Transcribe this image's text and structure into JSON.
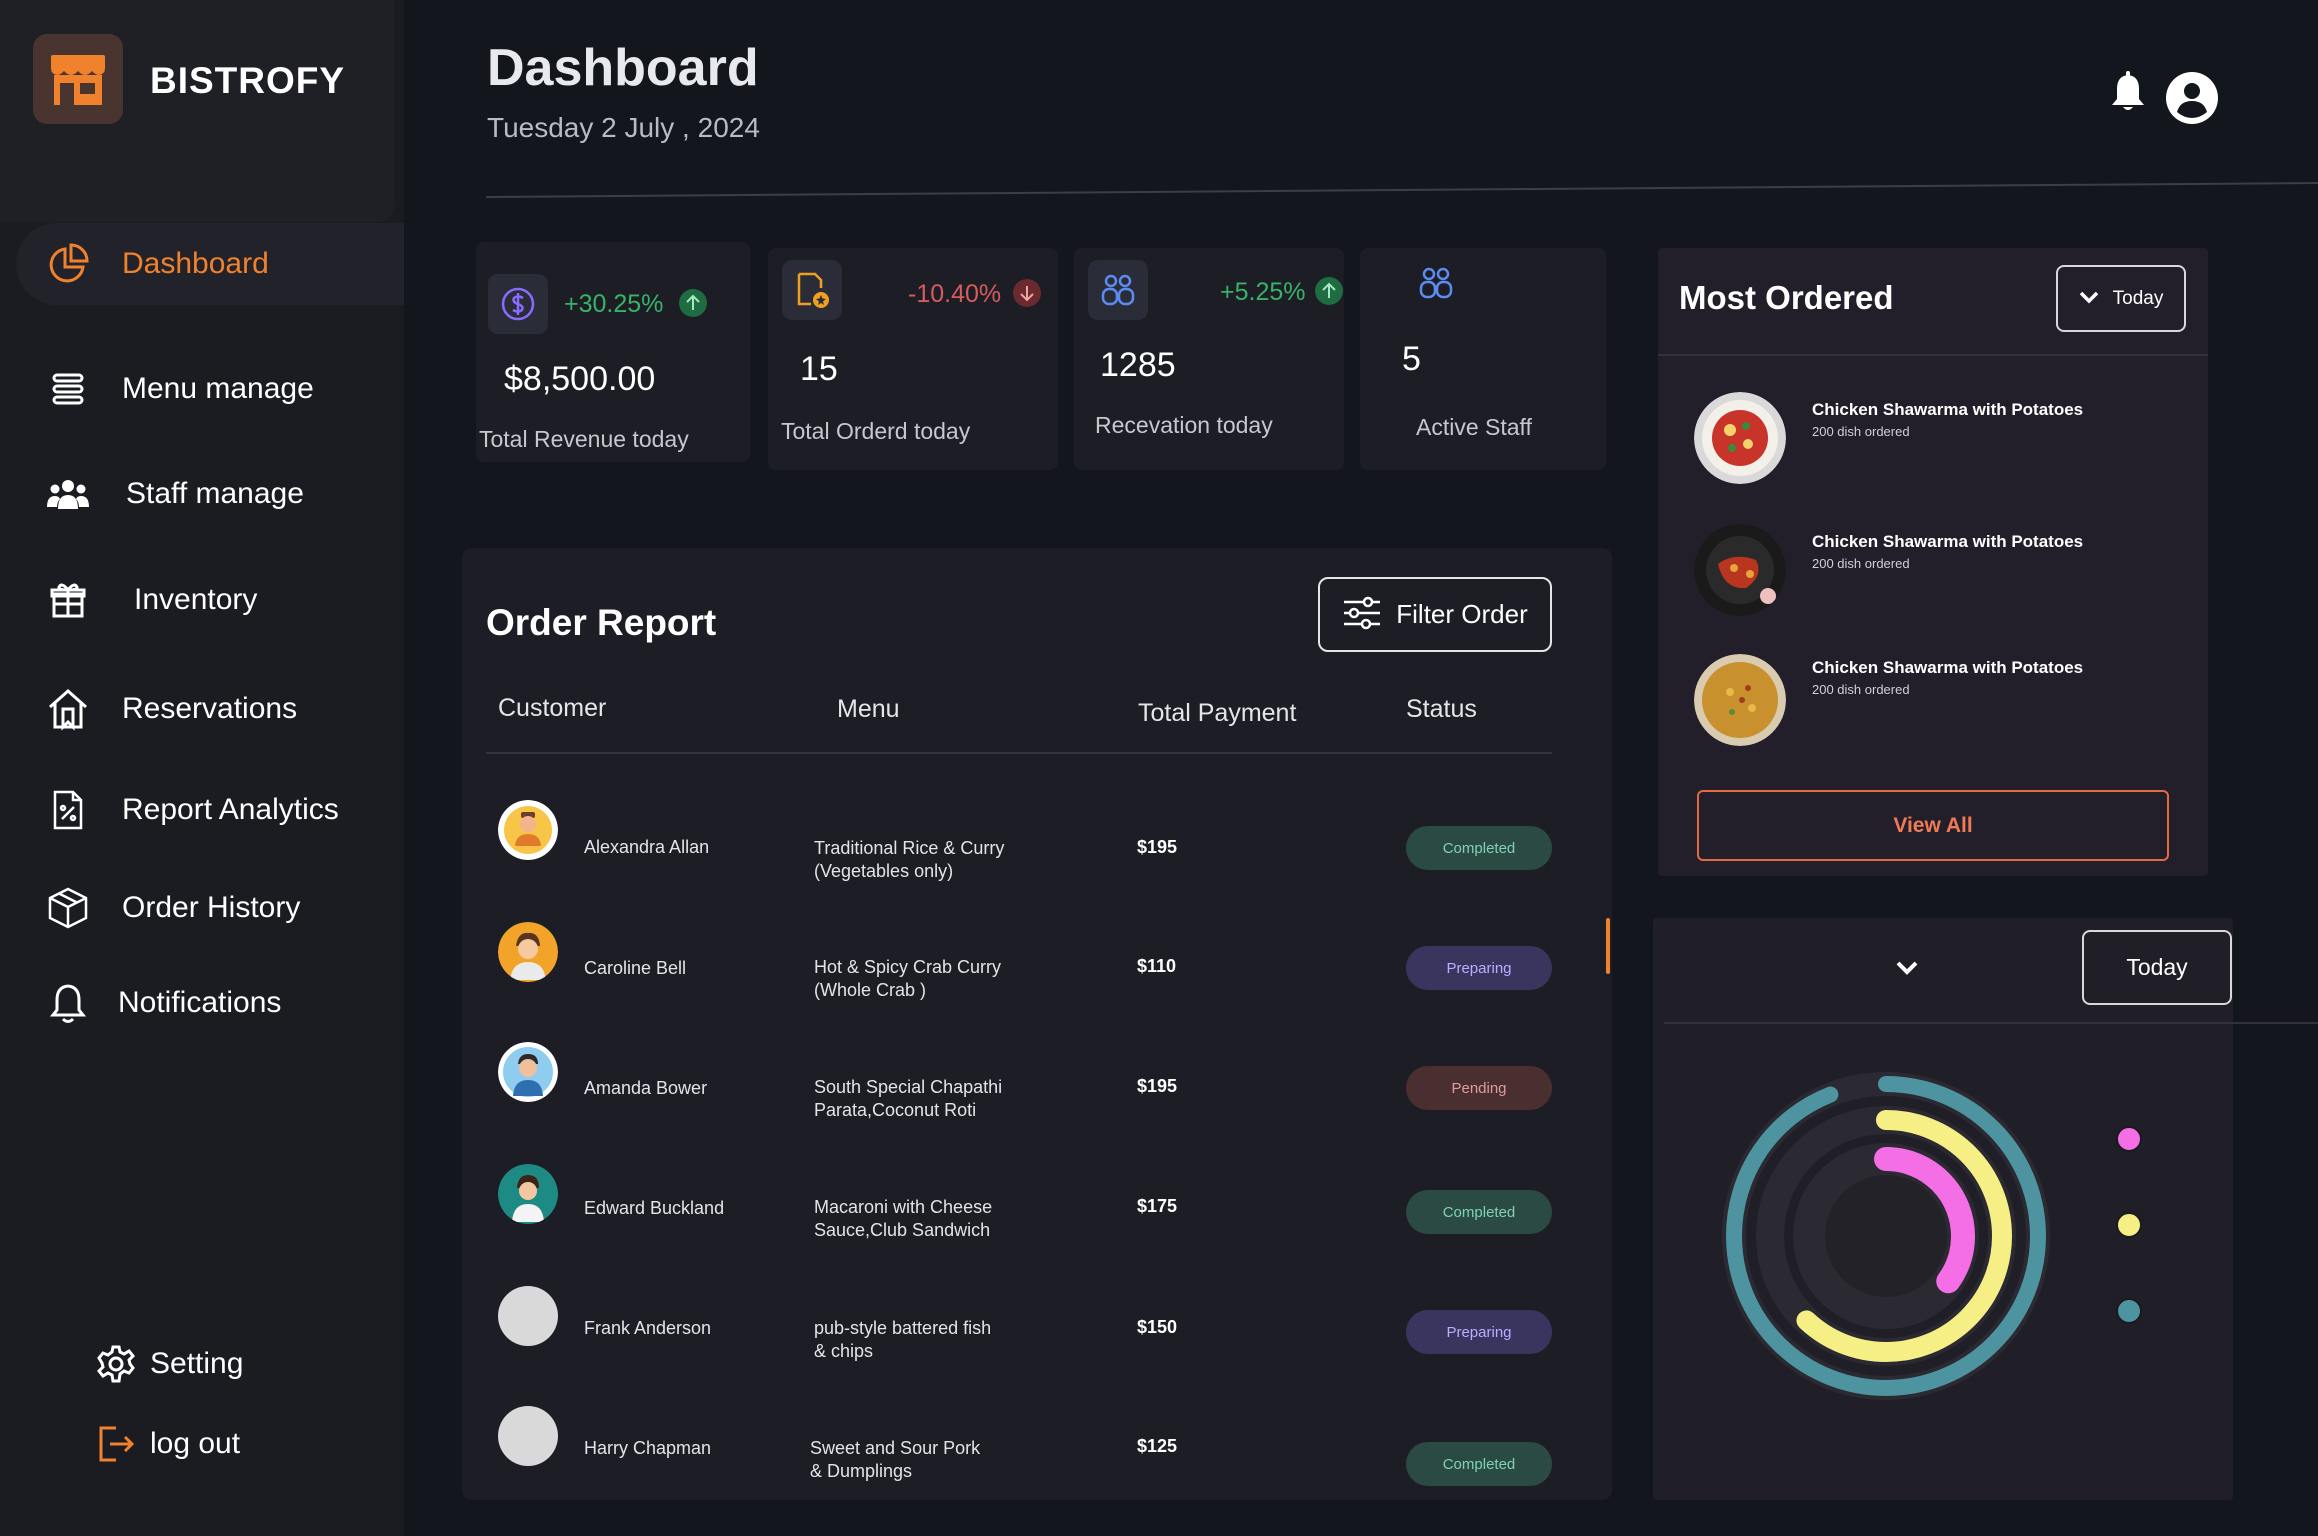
{
  "brand": {
    "name": "BISTROFY"
  },
  "sidebar": {
    "items": [
      {
        "label": "Dashboard",
        "active": true
      },
      {
        "label": "Menu manage"
      },
      {
        "label": "Staff manage"
      },
      {
        "label": "Inventory"
      },
      {
        "label": "Reservations"
      },
      {
        "label": "Report Analytics"
      },
      {
        "label": "Order History"
      },
      {
        "label": "Notifications"
      }
    ],
    "setting_label": "Setting",
    "logout_label": "log out"
  },
  "header": {
    "title": "Dashboard",
    "date": "Tuesday 2 July , 2024"
  },
  "stats": [
    {
      "change": "+30.25%",
      "direction": "up",
      "value": "$8,500.00",
      "label": "Total Revenue today",
      "icon": "dollar-icon"
    },
    {
      "change": "-10.40%",
      "direction": "down",
      "value": "15",
      "label": "Total Orderd today",
      "icon": "order-icon"
    },
    {
      "change": "+5.25%",
      "direction": "up",
      "value": "1285",
      "label": "Recevation today",
      "icon": "users-icon"
    },
    {
      "change": "",
      "direction": "",
      "value": "5",
      "label": "Active Staff",
      "icon": "users-icon"
    }
  ],
  "order_report": {
    "title": "Order Report",
    "filter_label": "Filter Order",
    "columns": [
      "Customer",
      "Menu",
      "Total Payment",
      "Status"
    ],
    "rows": [
      {
        "customer": "Alexandra Allan",
        "menu": [
          "Traditional Rice & Curry",
          "(Vegetables only)"
        ],
        "payment": "$195",
        "status": "Completed"
      },
      {
        "customer": "Caroline Bell",
        "menu": [
          "Hot & Spicy Crab Curry",
          "(Whole Crab )"
        ],
        "payment": "$110",
        "status": "Preparing"
      },
      {
        "customer": "Amanda Bower",
        "menu": [
          "South Special Chapathi",
          "Parata,Coconut Roti"
        ],
        "payment": "$195",
        "status": "Pending"
      },
      {
        "customer": "Edward Buckland",
        "menu": [
          "Macaroni with Cheese",
          "Sauce,Club Sandwich"
        ],
        "payment": "$175",
        "status": "Completed"
      },
      {
        "customer": "Frank Anderson",
        "menu": [
          "pub-style battered fish",
          "& chips"
        ],
        "payment": "$150",
        "status": "Preparing"
      },
      {
        "customer": "Harry Chapman",
        "menu": [
          "Sweet and Sour Pork",
          "& Dumplings"
        ],
        "payment": "$125",
        "status": "Completed"
      }
    ]
  },
  "most_ordered": {
    "title": "Most Ordered",
    "filter_label": "Today",
    "items": [
      {
        "name": "Chicken Shawarma with Potatoes",
        "sub": "200 dish ordered"
      },
      {
        "name": "Chicken Shawarma with Potatoes",
        "sub": "200 dish ordered"
      },
      {
        "name": "Chicken Shawarma with Potatoes",
        "sub": "200 dish ordered"
      }
    ],
    "view_all_label": "View All"
  },
  "chart_panel": {
    "filter_label": "Today",
    "colors": {
      "outer": "#4e94a0",
      "middle": "#f5ef85",
      "inner": "#f46fe6",
      "track": "#2b2a33"
    }
  },
  "chart_data": {
    "type": "pie",
    "style": "radial-rings",
    "series": [
      {
        "color": "#f46fe6",
        "value": 0.35
      },
      {
        "color": "#f5ef85",
        "value": 0.62
      },
      {
        "color": "#4e94a0",
        "value": 0.94
      }
    ]
  },
  "colors": {
    "accent": "#f0812d",
    "up": "#37b369",
    "down": "#d65b5b"
  }
}
